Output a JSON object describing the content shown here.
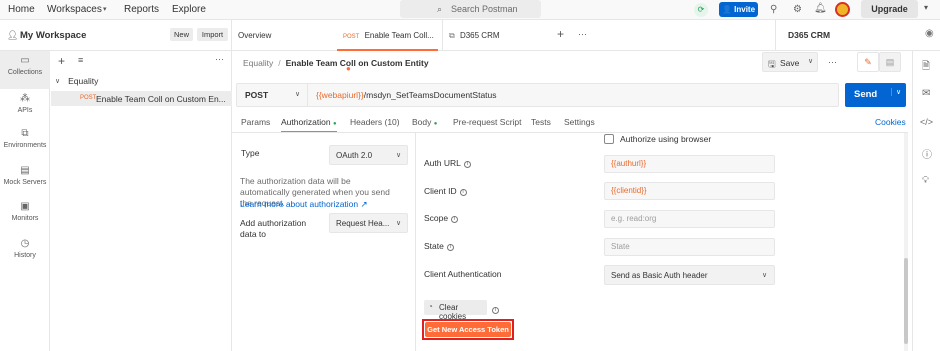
{
  "topbar": {
    "nav": [
      "Home",
      "Workspaces",
      "Reports",
      "Explore"
    ],
    "search_placeholder": "Search Postman",
    "invite_label": "Invite",
    "upgrade_label": "Upgrade"
  },
  "sidebar": {
    "workspace_name": "My Workspace",
    "new_label": "New",
    "import_label": "Import",
    "nav_items": [
      "Collections",
      "APIs",
      "Environments",
      "Mock Servers",
      "Monitors",
      "History"
    ],
    "tree_collection": "Equality",
    "tree_request_method": "POST",
    "tree_request_name": "Enable Team Coll on Custom En..."
  },
  "tabs": {
    "overview": "Overview",
    "active_method": "POST",
    "active_label": "Enable Team Coll...",
    "other_label": "D365 CRM",
    "environment": "D365 CRM"
  },
  "request": {
    "breadcrumb_collection": "Equality",
    "breadcrumb_request": "Enable Team Coll on Custom Entity",
    "save_label": "Save",
    "method": "POST",
    "url_var": "{{webapiurl}}",
    "url_rest": "/msdyn_SetTeamsDocumentStatus",
    "send_label": "Send",
    "cookies_label": "Cookies",
    "tabs": [
      "Params",
      "Authorization",
      "Headers (10)",
      "Body",
      "Pre-request Script",
      "Tests",
      "Settings"
    ]
  },
  "auth": {
    "type_label": "Type",
    "type_value": "OAuth 2.0",
    "note": "The authorization data will be automatically generated when you send the request.",
    "learn_more": "Learn more about authorization ↗",
    "add_to_label": "Add authorization data to",
    "add_to_value": "Request Hea...",
    "authorize_browser": "Authorize using browser",
    "auth_url_label": "Auth URL",
    "auth_url_value": "{{authurl}}",
    "client_id_label": "Client ID",
    "client_id_value": "{{clientid}}",
    "scope_label": "Scope",
    "scope_placeholder": "e.g. read:org",
    "state_label": "State",
    "state_placeholder": "State",
    "client_auth_label": "Client Authentication",
    "client_auth_value": "Send as Basic Auth header",
    "clear_cookies": "Clear cookies",
    "get_token": "Get New Access Token"
  },
  "colors": {
    "accent_blue": "#0265d2",
    "accent_orange": "#ff6c37",
    "highlight_red": "#e02020"
  }
}
